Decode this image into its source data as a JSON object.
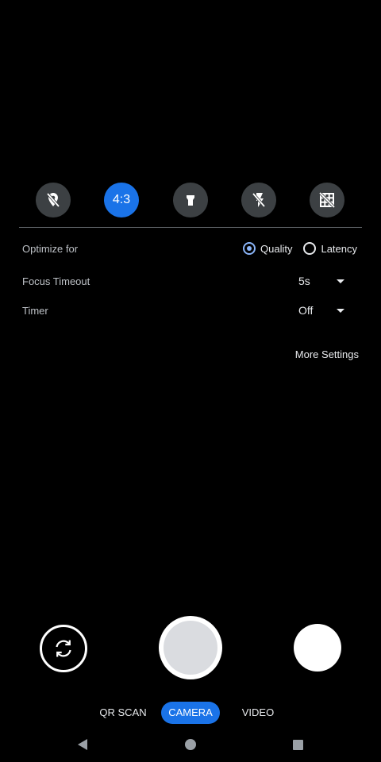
{
  "quick_toggles": {
    "location": {
      "icon": "location-off-icon"
    },
    "aspect_ratio": {
      "label": "4:3",
      "active": true
    },
    "torch": {
      "icon": "flashlight-icon"
    },
    "flash": {
      "icon": "flash-off-icon"
    },
    "grid": {
      "icon": "grid-off-icon"
    }
  },
  "settings": {
    "optimize_for": {
      "label": "Optimize for",
      "options": [
        "Quality",
        "Latency"
      ],
      "selected": "Quality"
    },
    "focus_timeout": {
      "label": "Focus Timeout",
      "value": "5s"
    },
    "timer": {
      "label": "Timer",
      "value": "Off"
    },
    "more_settings": "More Settings"
  },
  "controls": {
    "switch_camera_icon": "switch-camera-icon",
    "shutter_icon": "shutter-icon",
    "thumbnail_icon": "gallery-thumbnail"
  },
  "modes": {
    "items": [
      "QR SCAN",
      "CAMERA",
      "VIDEO"
    ],
    "selected": "CAMERA"
  },
  "nav": {
    "back_icon": "back-icon",
    "home_icon": "home-icon",
    "recents_icon": "recents-icon"
  },
  "colors": {
    "background": "#000000",
    "accent": "#1a73e8",
    "toggle_bg": "#3c4043",
    "radio_accent": "#8ab4f8"
  }
}
